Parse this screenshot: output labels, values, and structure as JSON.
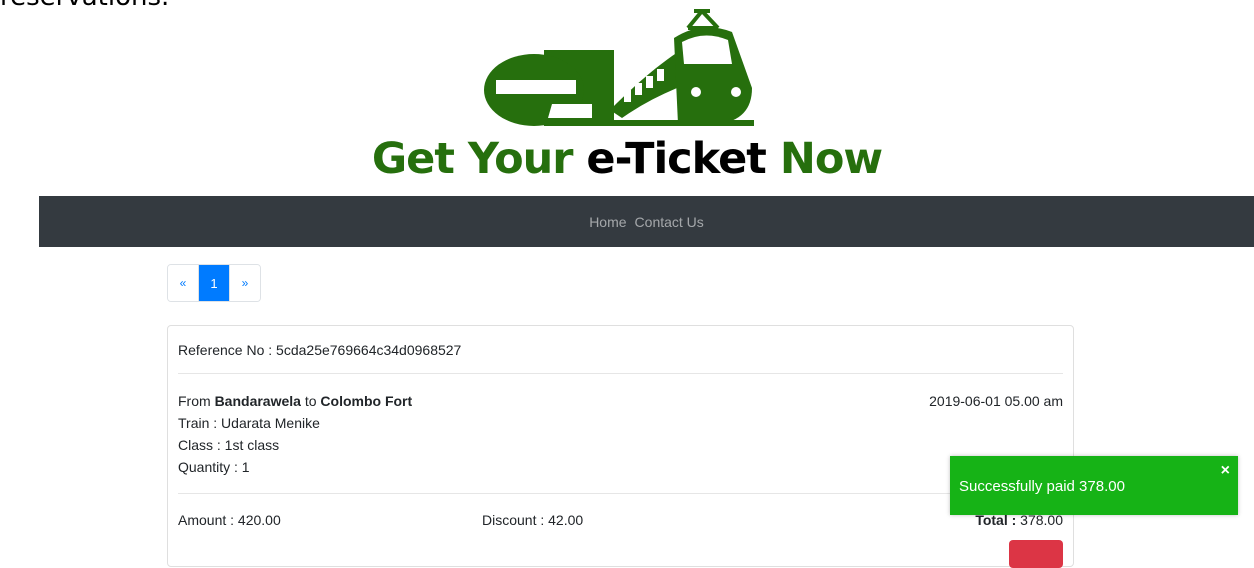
{
  "header": {
    "clipped_text": "reservations.",
    "tagline_part1": "Get Your",
    "tagline_part2": "e-Ticket",
    "tagline_part3": "Now"
  },
  "nav": {
    "items": [
      {
        "label": "Home"
      },
      {
        "label": "Contact Us"
      }
    ]
  },
  "pagination": {
    "prev": "«",
    "current": "1",
    "next": "»"
  },
  "booking": {
    "reference_label": "Reference No : 5cda25e769664c34d0968527",
    "from_prefix": "From",
    "from": "Bandarawela",
    "to_prefix": "to",
    "to": "Colombo Fort",
    "datetime": "2019-06-01 05.00 am",
    "train": "Train : Udarata Menike",
    "class": "Class : 1st class",
    "quantity": "Quantity : 1",
    "amount": "Amount : 420.00",
    "discount": "Discount : 42.00",
    "total_label": "Total :",
    "total_value": "378.00"
  },
  "toast": {
    "message": "Successfully paid 378.00",
    "close": "×"
  },
  "colors": {
    "brand_green": "#266f0d",
    "navbar": "#343a40",
    "primary": "#007bff",
    "toast_green": "#16b316",
    "danger": "#dc3545"
  }
}
